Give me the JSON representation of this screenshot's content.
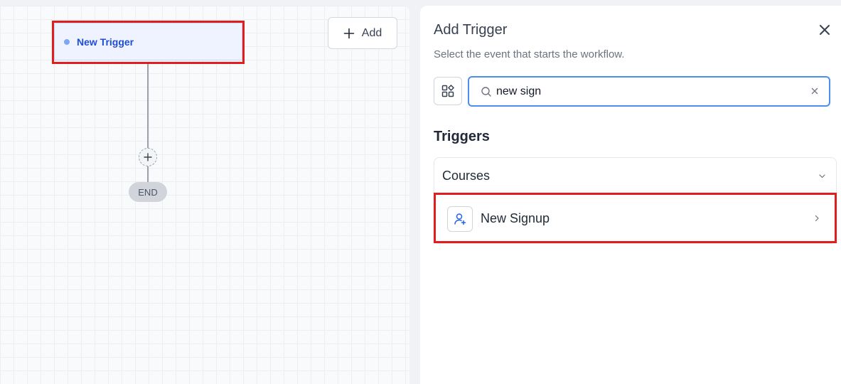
{
  "canvas": {
    "add_button_label": "Add",
    "trigger_node_label": "New Trigger",
    "end_node_label": "END"
  },
  "panel": {
    "title": "Add Trigger",
    "subtitle": "Select the event that starts the workflow.",
    "search": {
      "value": "new sign",
      "placeholder": ""
    },
    "section_title": "Triggers",
    "groups": [
      {
        "label": "Courses",
        "items": [
          {
            "label": "New Signup",
            "icon": "user-plus-icon"
          }
        ]
      }
    ]
  },
  "colors": {
    "accent": "#1d4ed8",
    "highlight": "#e01e1e",
    "search_focus": "#4b8ef0"
  }
}
